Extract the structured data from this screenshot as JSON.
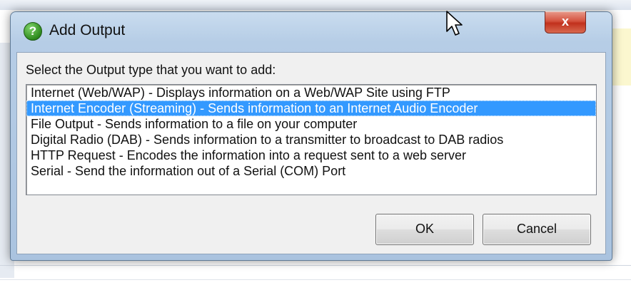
{
  "dialog": {
    "title": "Add Output",
    "title_icon": "question-icon",
    "close_label": "x"
  },
  "prompt": "Select the Output type that you want to add:",
  "options": [
    {
      "label": "Internet (Web/WAP) - Displays information on a Web/WAP Site using FTP",
      "selected": false
    },
    {
      "label": "Internet Encoder (Streaming) - Sends information to an Internet Audio Encoder",
      "selected": true
    },
    {
      "label": "File Output - Sends information to a file on your computer",
      "selected": false
    },
    {
      "label": "Digital Radio (DAB) - Sends information to a transmitter to broadcast to DAB radios",
      "selected": false
    },
    {
      "label": "HTTP Request - Encodes the information into a request sent to a web server",
      "selected": false
    },
    {
      "label": "Serial - Send the information out of a Serial (COM) Port",
      "selected": false
    }
  ],
  "buttons": {
    "ok_label": "OK",
    "cancel_label": "Cancel"
  },
  "colors": {
    "selection": "#3399ff",
    "close_button": "#c1311d",
    "frame": "#aac3df"
  }
}
